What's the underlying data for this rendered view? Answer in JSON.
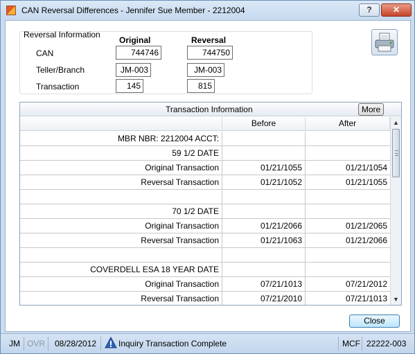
{
  "window": {
    "title": "CAN Reversal Differences - Jennifer Sue Member - 2212004",
    "help_label": "?",
    "close_label": "✕"
  },
  "reversal_info": {
    "group_label": "Reversal Information",
    "col_original": "Original",
    "col_reversal": "Reversal",
    "rows": [
      {
        "label": "CAN",
        "original": "744746",
        "reversal": "744750"
      },
      {
        "label": "Teller/Branch",
        "original": "JM-003",
        "reversal": "JM-003"
      },
      {
        "label": "Transaction",
        "original": "145",
        "reversal": "815"
      }
    ]
  },
  "transaction_info": {
    "caption": "Transaction Information",
    "more_label": "More",
    "columns": [
      "",
      "Before",
      "After"
    ],
    "rows": [
      [
        "MBR NBR:     2212004  ACCT:",
        "",
        ""
      ],
      [
        "59 1/2 DATE",
        "",
        ""
      ],
      [
        "Original Transaction",
        "01/21/1055",
        "01/21/1054"
      ],
      [
        "Reversal Transaction",
        "01/21/1052",
        "01/21/1055"
      ],
      [
        "",
        "",
        ""
      ],
      [
        "70 1/2 DATE",
        "",
        ""
      ],
      [
        "Original Transaction",
        "01/21/2066",
        "01/21/2065"
      ],
      [
        "Reversal Transaction",
        "01/21/1063",
        "01/21/2066"
      ],
      [
        "",
        "",
        ""
      ],
      [
        "COVERDELL ESA 18 YEAR DATE",
        "",
        ""
      ],
      [
        "Original Transaction",
        "07/21/1013",
        "07/21/2012"
      ],
      [
        "Reversal Transaction",
        "07/21/2010",
        "07/21/1013"
      ]
    ]
  },
  "actions": {
    "close_label": "Close"
  },
  "statusbar": {
    "user": "JM",
    "ovr": "OVR",
    "date": "08/28/2012",
    "message": "Inquiry Transaction Complete",
    "system": "MCF",
    "session": "22222-003"
  },
  "icons": {
    "app": "app-icon",
    "printer": "printer-icon",
    "info": "info-icon"
  }
}
